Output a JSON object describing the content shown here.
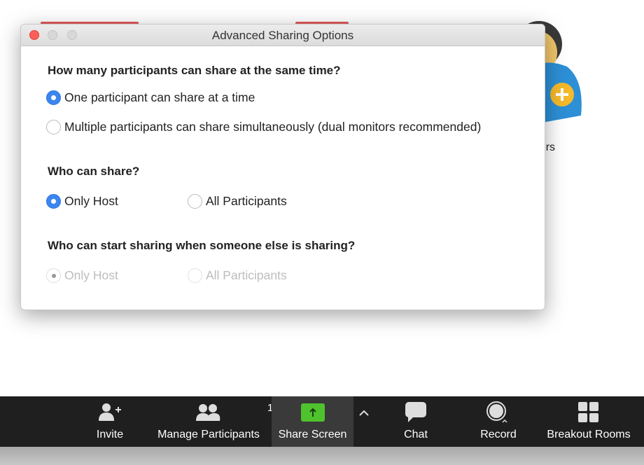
{
  "background": {
    "others_label": "Others"
  },
  "dialog": {
    "title": "Advanced Sharing Options",
    "sections": [
      {
        "question": "How many participants can share at the same time?",
        "options": [
          {
            "label": "One participant can share at a time",
            "selected": true
          },
          {
            "label": "Multiple participants can share simultaneously (dual monitors recommended)",
            "selected": false
          }
        ]
      },
      {
        "question": "Who can share?",
        "options": [
          {
            "label": "Only Host",
            "selected": true
          },
          {
            "label": "All Participants",
            "selected": false
          }
        ]
      },
      {
        "question": "Who can start sharing when someone else is sharing?",
        "disabled": true,
        "options": [
          {
            "label": "Only Host",
            "selected": true
          },
          {
            "label": "All Participants",
            "selected": false
          }
        ]
      }
    ]
  },
  "toolbar": {
    "items": [
      {
        "label": "Invite",
        "icon": "invite-icon"
      },
      {
        "label": "Manage Participants",
        "icon": "participants-icon",
        "count": "1"
      },
      {
        "label": "Share Screen",
        "icon": "share-screen-icon",
        "active": true
      },
      {
        "label": "Chat",
        "icon": "chat-icon"
      },
      {
        "label": "Record",
        "icon": "record-icon"
      },
      {
        "label": "Breakout Rooms",
        "icon": "breakout-rooms-icon"
      }
    ],
    "accent": "#4fc32d"
  }
}
